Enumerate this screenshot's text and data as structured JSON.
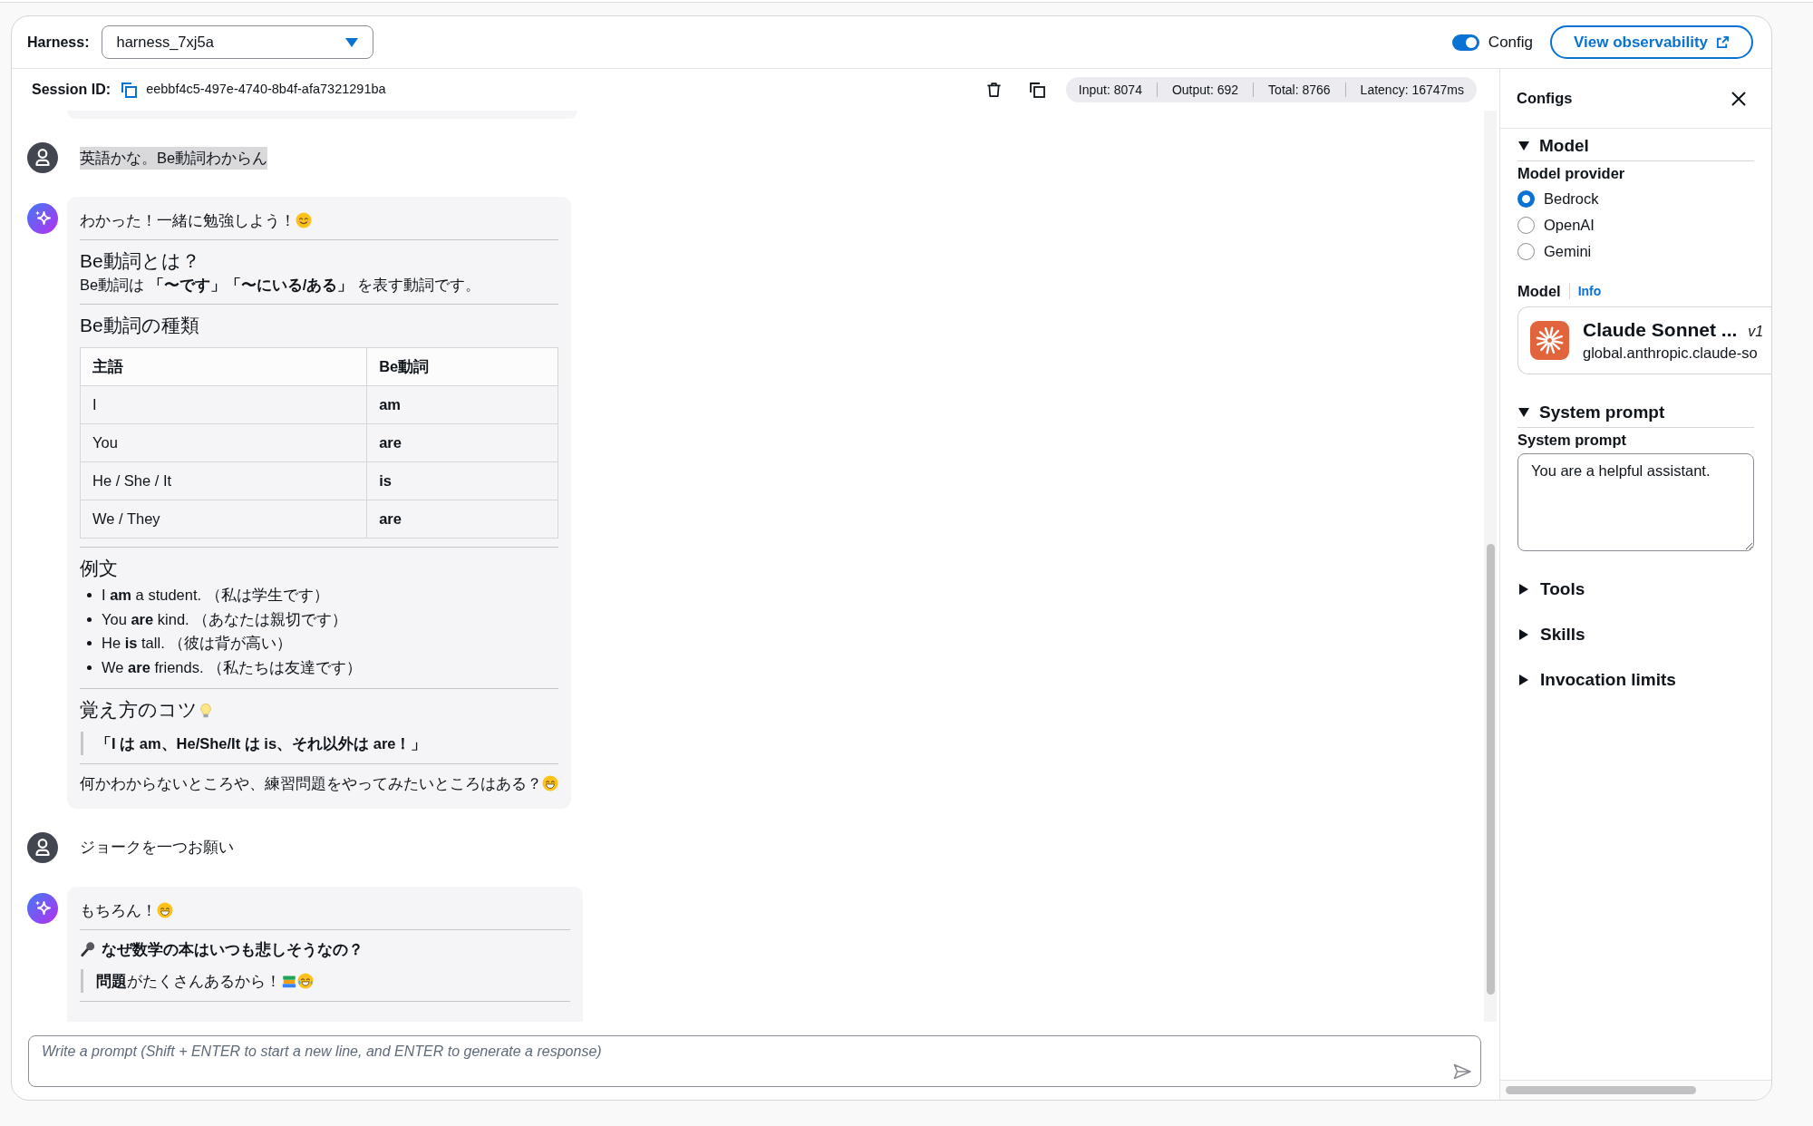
{
  "header": {
    "harness_label": "Harness:",
    "harness_select": {
      "value": "harness_7xj5a"
    },
    "config_toggle": {
      "label": "Config",
      "on": true
    },
    "observability_button": {
      "label": "View observability"
    }
  },
  "session_bar": {
    "label": "Session ID:",
    "session_id": "eebbf4c5-497e-4740-8b4f-afa7321291ba",
    "stats": [
      "Input: 8074",
      "Output: 692",
      "Total: 8766",
      "Latency: 16747ms"
    ]
  },
  "chat": {
    "messages": [
      {
        "kind": "bubble_tail"
      },
      {
        "kind": "user",
        "text": "英語かな。Be動詞わからん",
        "highlighted": true
      },
      {
        "kind": "assistant",
        "continues_below": false,
        "blocks": [
          {
            "kind": "paragraph",
            "bold": false,
            "text": "わかった！一緒に勉強しよう！",
            "trailing_icons": [
              {
                "kind": "smiling"
              }
            ]
          },
          {
            "kind": "rule"
          },
          {
            "kind": "heading",
            "text": "Be動詞とは？"
          },
          {
            "kind": "paragraph",
            "bold": false,
            "text": "Be動詞は **「〜です」「〜にいる/ある」** を表す動詞です。"
          },
          {
            "kind": "rule"
          },
          {
            "kind": "heading",
            "text": "Be動詞の種類"
          },
          {
            "kind": "table",
            "columns": [
              {
                "label": "主語",
                "bold_cells": false
              },
              {
                "label": "Be動詞",
                "bold_cells": true
              }
            ],
            "rows": [
              [
                "I",
                "am"
              ],
              [
                "You",
                "are"
              ],
              [
                "He / She / It",
                "is"
              ],
              [
                "We / They",
                "are"
              ]
            ]
          },
          {
            "kind": "rule"
          },
          {
            "kind": "heading",
            "text": "例文"
          },
          {
            "kind": "list",
            "items": [
              "I **am** a student. （私は学生です）",
              "You **are** kind. （あなたは親切です）",
              "He **is** tall. （彼は背が高い）",
              "We **are** friends. （私たちは友達です）"
            ]
          },
          {
            "kind": "rule"
          },
          {
            "kind": "heading",
            "text": "覚え方のコツ",
            "trailing_icons": [
              {
                "kind": "lightbulb"
              }
            ]
          },
          {
            "kind": "quote",
            "bold": true,
            "text": "「I は am、He/She/It は is、それ以外は are！」"
          },
          {
            "kind": "rule"
          },
          {
            "kind": "paragraph",
            "bold": false,
            "text": "何かわからないところや、練習問題をやってみたいところはある？",
            "trailing_icons": [
              {
                "kind": "grinning"
              }
            ]
          }
        ]
      },
      {
        "kind": "user",
        "text": "ジョークを一つお願い",
        "highlighted": false
      },
      {
        "kind": "assistant",
        "continues_below": true,
        "blocks": [
          {
            "kind": "paragraph",
            "bold": false,
            "text": "もちろん！",
            "trailing_icons": [
              {
                "kind": "grinning"
              }
            ]
          },
          {
            "kind": "rule"
          },
          {
            "kind": "paragraph",
            "bold": true,
            "text": "なぜ数学の本はいつも悲しそうなの？",
            "leading_icons": [
              {
                "kind": "microphone"
              }
            ]
          },
          {
            "kind": "quote",
            "bold": false,
            "text": "**問題**がたくさんあるから！",
            "trailing_icons": [
              {
                "kind": "books"
              },
              {
                "kind": "tears_of_joy"
              }
            ]
          },
          {
            "kind": "rule"
          }
        ]
      }
    ]
  },
  "prompt_input": {
    "placeholder": "Write a prompt (Shift + ENTER to start a new line, and ENTER to generate a response)"
  },
  "config_panel": {
    "title": "Configs",
    "sections": [
      {
        "kind": "model",
        "title": "Model",
        "expanded": true,
        "provider_label": "Model provider",
        "providers": [
          {
            "label": "Bedrock",
            "selected": true
          },
          {
            "label": "OpenAI",
            "selected": false
          },
          {
            "label": "Gemini",
            "selected": false
          }
        ],
        "model_label": "Model",
        "info_link": "Info",
        "model_card": {
          "name": "Claude Sonnet ...",
          "version": "v1",
          "model_id": "global.anthropic.claude-so"
        }
      },
      {
        "kind": "system_prompt",
        "title": "System prompt",
        "expanded": true,
        "field_label": "System prompt",
        "value": "You are a helpful assistant."
      },
      {
        "kind": "plain",
        "title": "Tools",
        "expanded": false
      },
      {
        "kind": "plain",
        "title": "Skills",
        "expanded": false
      },
      {
        "kind": "plain",
        "title": "Invocation limits",
        "expanded": false
      }
    ]
  }
}
